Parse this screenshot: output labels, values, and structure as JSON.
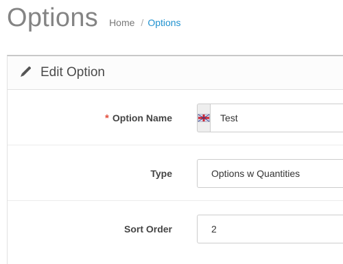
{
  "header": {
    "title": "Options",
    "breadcrumb": {
      "home": "Home",
      "separator": "/",
      "current": "Options"
    }
  },
  "panel": {
    "title": "Edit Option",
    "icon": "pencil-icon"
  },
  "form": {
    "option_name": {
      "label": "Option Name",
      "required_mark": "*",
      "value": "Test",
      "language_icon": "flag-icon"
    },
    "type": {
      "label": "Type",
      "value": "Options w Quantities"
    },
    "sort_order": {
      "label": "Sort Order",
      "value": "2"
    }
  },
  "colors": {
    "link": "#1e91cf",
    "required": "#e3503e"
  }
}
